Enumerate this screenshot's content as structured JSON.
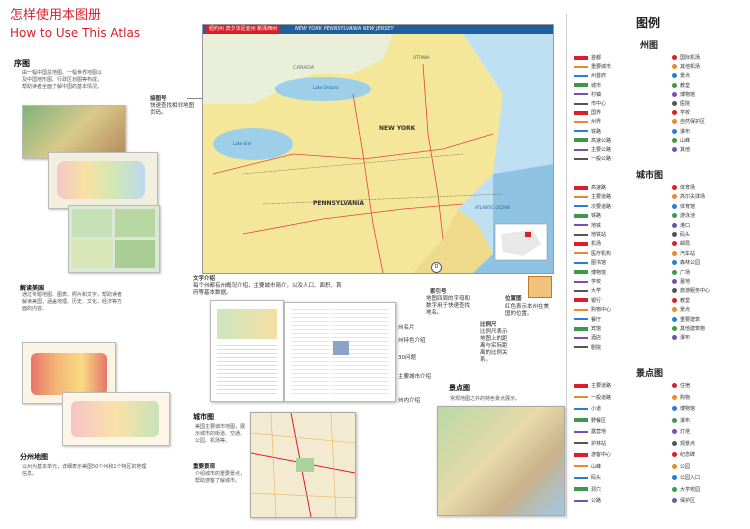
{
  "header": {
    "title_cn": "怎样使用本图册",
    "title_en": "How to Use This Atlas"
  },
  "left": {
    "preface": {
      "title": "序图",
      "text": "由一幅中国总地图、一幅世界地图以及中国地形图、行政区划图等构成，帮助读者全面了解中国的基本情况。"
    },
    "interpret": {
      "title": "解读美国",
      "text": "通过专题地图、图表、照片和文字，帮助读者解读美国，涵盖地理、历史、文化、经济等方面的内容。"
    },
    "state_map": {
      "title": "分州地图",
      "text": "以州为基本单元，详细表示美国50个州和1个特区的地理信息。"
    }
  },
  "center": {
    "topbar_red": "纽约州 宾夕法尼亚州 新泽西州",
    "topbar_title": "NEW YORK PENNSYLVANIA NEW JERSEY",
    "map_labels": {
      "ny": "NEW YORK",
      "pa": "PENNSYLVANIA",
      "atlantic": "ATLANTIC OCEAN",
      "ontario": "Lake Ontario",
      "erie": "Lake Erie",
      "ottawa": "OTTAWA",
      "canada": "CANADA"
    },
    "callout_page_no": {
      "title": "接图号",
      "text": "快速查找相邻地图页码。"
    },
    "callout_text_intro": {
      "title": "文字介绍",
      "text": "每个州都有州概况介绍，主要城市简介，以及人口、面积、首府等基本数据。"
    },
    "callout_index_d": "D",
    "callout_index": {
      "title": "索引号",
      "text": "地图四周的字母和数字用于快速查找地名。"
    },
    "callout_scale": {
      "title": "比例尺",
      "text": "比例尺表示地图上的距离与实际距离的比例关系。"
    },
    "callout_locator": {
      "title": "位置图",
      "text": "红色表示本州在美国的位置。"
    },
    "spread_labels": [
      "州名片",
      "州特色介绍",
      "30问题",
      "主要城市介绍",
      "州内介绍"
    ],
    "city_map": {
      "title": "城市图",
      "text": "美国主要城市地图，展示城市的街道、交通、公园、机场等。"
    },
    "important_text": {
      "title": "重要景观",
      "text": "介绍城市的重要景点，帮助游客了解城市。"
    },
    "scenic": {
      "title": "景点图",
      "text": "常规地图之外的特色景点展示。"
    }
  },
  "legend": {
    "title": "图例",
    "state_section": "州图",
    "city_section": "城市图",
    "scenic_section": "景点图",
    "state_left": [
      "首都",
      "重要城市",
      "州首府",
      "城市",
      "村镇",
      "市中心",
      "国界",
      "州界",
      "铁路",
      "高速公路",
      "主要公路",
      "一般公路"
    ],
    "state_right": [
      "国际机场",
      "其他机场",
      "景点",
      "教堂",
      "博物馆",
      "医院",
      "学校",
      "自然保护区",
      "瀑布",
      "山峰",
      "其他"
    ],
    "city_left": [
      "高速路",
      "主要道路",
      "次要道路",
      "铁路",
      "地铁",
      "地铁站",
      "机场",
      "医疗机构",
      "图书馆",
      "博物馆",
      "学校",
      "大学",
      "银行",
      "购物中心",
      "餐厅",
      "宾馆",
      "酒店",
      "剧院"
    ],
    "city_right": [
      "体育场",
      "高尔夫球场",
      "体育馆",
      "游泳池",
      "港口",
      "码头",
      "邮局",
      "汽车站",
      "森林公园",
      "广场",
      "墓地",
      "旅游服务中心",
      "教堂",
      "景点",
      "重要建筑",
      "其他建筑物",
      "瀑布"
    ],
    "scenic_left": [
      "主要道路",
      "一般道路",
      "小道",
      "野餐区",
      "露营地",
      "护林站",
      "游客中心",
      "山峰",
      "码头",
      "洞穴",
      "公路"
    ],
    "scenic_right": [
      "住宿",
      "购物",
      "博物馆",
      "瀑布",
      "灯塔",
      "观景点",
      "纪念碑",
      "公园",
      "公园入口",
      "大学校园",
      "保护区"
    ]
  },
  "colors": {
    "accent": "#d9202a",
    "land": "#f4e79a",
    "water": "#bfe0f2"
  }
}
